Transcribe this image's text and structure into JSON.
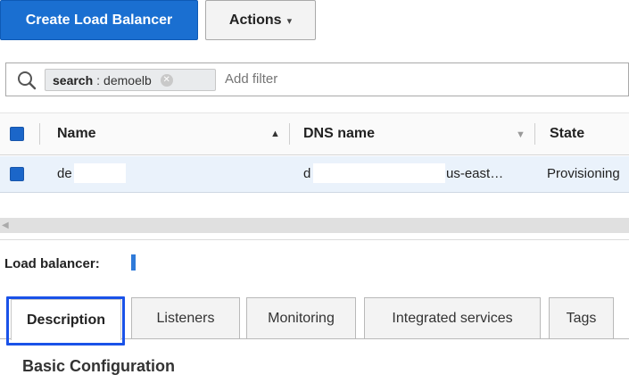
{
  "toolbar": {
    "create_label": "Create Load Balancer",
    "actions_label": "Actions"
  },
  "filter": {
    "token_key": "search",
    "token_sep": ":",
    "token_value": "demoelb",
    "add_filter": "Add filter"
  },
  "table": {
    "columns": {
      "name": "Name",
      "dns": "DNS name",
      "state": "State"
    },
    "rows": [
      {
        "name": "de",
        "dns_prefix": "d",
        "dns_suffix": "us-east…",
        "state": "Provisioning"
      }
    ]
  },
  "detail": {
    "lb_label": "Load balancer:",
    "tabs": [
      "Description",
      "Listeners",
      "Monitoring",
      "Integrated services",
      "Tags"
    ],
    "section_title": "Basic Configuration"
  },
  "colors": {
    "primary": "#1a6fd1",
    "checkbox": "#1b66c9",
    "focus": "#1a52e8",
    "row_selected": "#eaf2fb"
  }
}
